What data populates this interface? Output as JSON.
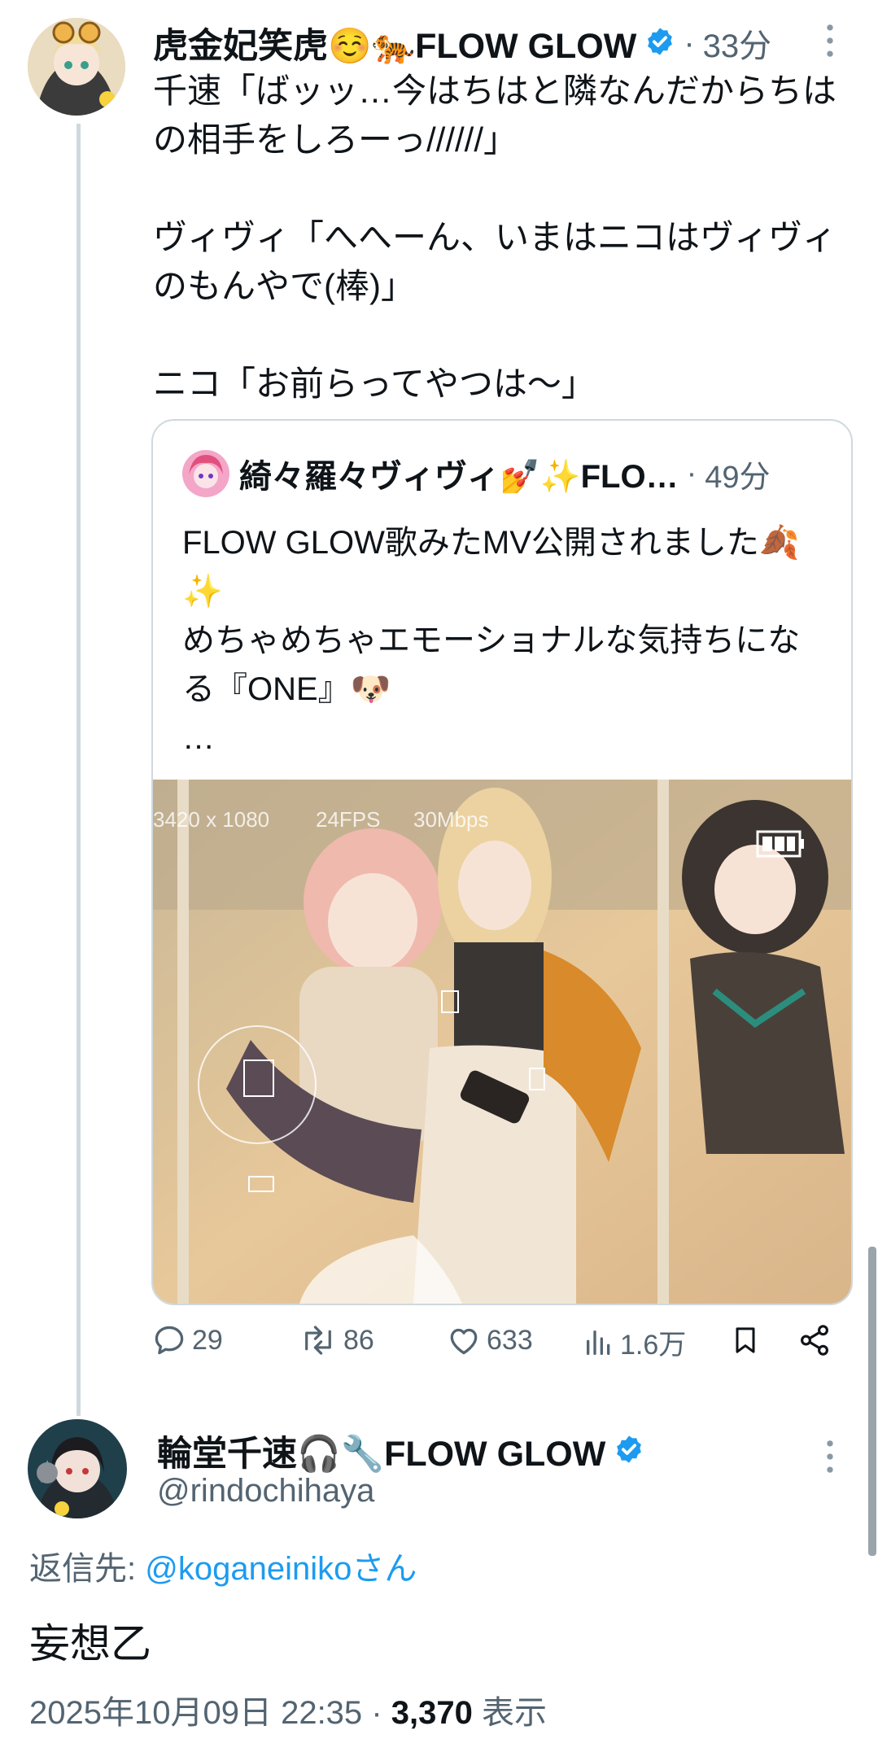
{
  "main_tweet": {
    "display_name": "虎金妃笑虎☺️🐅FLOW GLOW",
    "time": "33分",
    "text": "千速「ばッッ…今はちはと隣なんだからちはの相手をしろーっ//////」\n\nヴィヴィ「へへーん、いまはニコはヴィヴィのもんやで(棒)」\n\nニコ「お前らってやつは〜」"
  },
  "quoted_tweet": {
    "display_name": "綺々羅々ヴィヴィ💅✨FLO…",
    "time": "49分",
    "text": "FLOW GLOW歌みたMV公開されました🍂✨\nめちゃめちゃエモーショナルな気持ちになる『ONE』🐶\n…",
    "media_overlay": {
      "resolution": "3420 x 1080",
      "fps": "24FPS",
      "bitrate": "30Mbps"
    }
  },
  "actions": {
    "reply_count": "29",
    "retweet_count": "86",
    "like_count": "633",
    "view_count": "1.6万"
  },
  "reply_tweet": {
    "display_name": "輪堂千速🎧🔧FLOW GLOW",
    "handle": "@rindochihaya",
    "reply_to_label": "返信先: ",
    "reply_to_handle": "@koganeinikoさん",
    "text": "妄想乙",
    "date": "2025年10月09日 22:35",
    "views": "3,370",
    "views_label": "表示"
  },
  "colors": {
    "accent": "#1d9bf0",
    "secondary_text": "#536471",
    "border": "#cfd9de"
  },
  "icons": [
    "verified-badge-icon",
    "more-icon",
    "reply-icon",
    "retweet-icon",
    "like-icon",
    "views-icon",
    "bookmark-icon",
    "share-icon"
  ]
}
